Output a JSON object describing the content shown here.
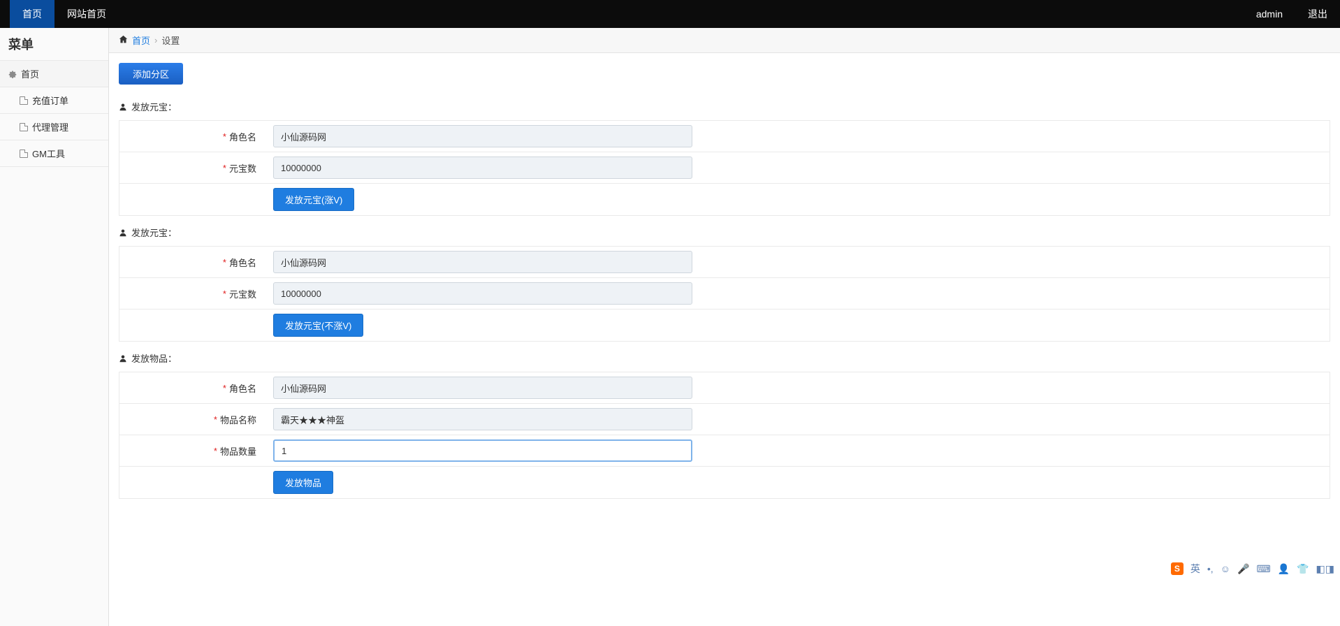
{
  "topbar": {
    "home": "首页",
    "site_home": "网站首页",
    "user": "admin",
    "logout": "退出"
  },
  "sidebar": {
    "title": "菜单",
    "root": "首页",
    "items": [
      {
        "label": "充值订单"
      },
      {
        "label": "代理管理"
      },
      {
        "label": "GM工具"
      }
    ]
  },
  "breadcrumb": {
    "home_link": "首页",
    "current": "设置"
  },
  "zone_btn": "添加分区",
  "sections": [
    {
      "title": "发放元宝：",
      "rows": [
        {
          "label": "角色名",
          "value": "小仙源码网"
        },
        {
          "label": "元宝数",
          "value": "10000000"
        }
      ],
      "button": "发放元宝(涨V)"
    },
    {
      "title": "发放元宝：",
      "rows": [
        {
          "label": "角色名",
          "value": "小仙源码网"
        },
        {
          "label": "元宝数",
          "value": "10000000"
        }
      ],
      "button": "发放元宝(不涨V)"
    },
    {
      "title": "发放物品：",
      "rows": [
        {
          "label": "角色名",
          "value": "小仙源码网"
        },
        {
          "label": "物品名称",
          "value": "霸天★★★神盔"
        },
        {
          "label": "物品数量",
          "value": "1",
          "focused": true
        }
      ],
      "button": "发放物品"
    }
  ],
  "ime": {
    "badge": "S",
    "lang": "英"
  }
}
